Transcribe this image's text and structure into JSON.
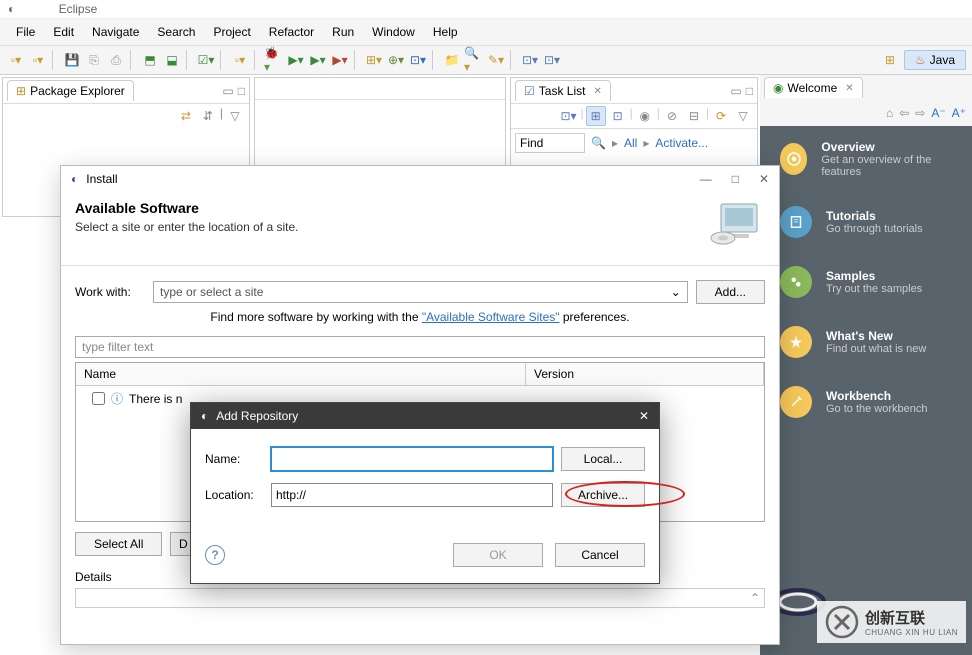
{
  "title_partial": "Eclipse",
  "menu": [
    "File",
    "Edit",
    "Navigate",
    "Search",
    "Project",
    "Refactor",
    "Run",
    "Window",
    "Help"
  ],
  "perspective": {
    "label": "Java"
  },
  "pkg_explorer": {
    "title": "Package Explorer"
  },
  "task_list": {
    "title": "Task List",
    "find_placeholder": "Find",
    "all": "All",
    "activate": "Activate..."
  },
  "welcome": {
    "title": "Welcome",
    "items": [
      {
        "h": "Overview",
        "p": "Get an overview of the features"
      },
      {
        "h": "Tutorials",
        "p": "Go through tutorials"
      },
      {
        "h": "Samples",
        "p": "Try out the samples"
      },
      {
        "h": "What's New",
        "p": "Find out what is new"
      },
      {
        "h": "Workbench",
        "p": "Go to the workbench"
      }
    ]
  },
  "install": {
    "win_title": "Install",
    "heading": "Available Software",
    "sub": "Select a site or enter the location of a site.",
    "work_with": "Work with:",
    "combo_placeholder": "type or select a site",
    "add": "Add...",
    "hint_pre": "Find more software by working with the ",
    "hint_link": "\"Available Software Sites\"",
    "hint_post": " preferences.",
    "filter_placeholder": "type filter text",
    "col_name": "Name",
    "col_version": "Version",
    "row_text": "There is n",
    "select_all": "Select All",
    "deselect": "D",
    "details": "Details"
  },
  "addrepo": {
    "title": "Add Repository",
    "name_label": "Name:",
    "name_value": "",
    "loc_label": "Location:",
    "loc_value": "http://",
    "local": "Local...",
    "archive": "Archive...",
    "ok": "OK",
    "cancel": "Cancel"
  },
  "brand": {
    "cn": "创新互联",
    "py": "CHUANG XIN HU LIAN"
  }
}
